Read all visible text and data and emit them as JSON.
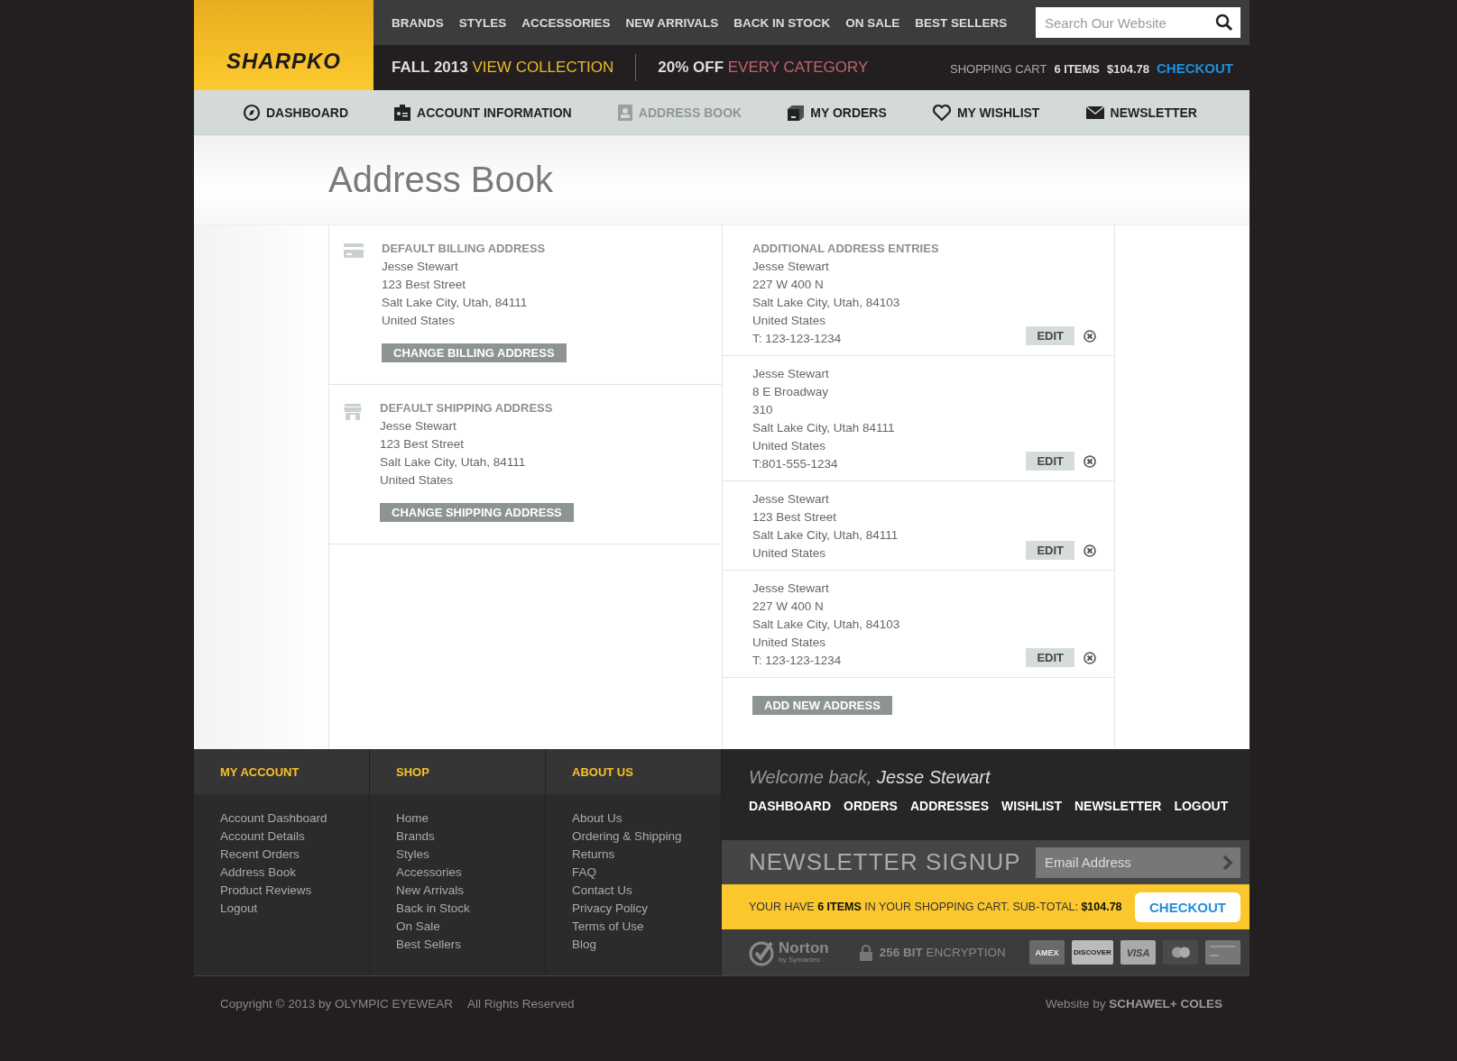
{
  "logo": "SHARPKO",
  "top_nav": [
    "BRANDS",
    "STYLES",
    "ACCESSORIES",
    "NEW ARRIVALS",
    "BACK IN STOCK",
    "ON SALE",
    "BEST SELLERS"
  ],
  "search": {
    "placeholder": "Search Our Website"
  },
  "promos": [
    {
      "lead": "FALL 2013",
      "link": "VIEW COLLECTION",
      "color": "#e9b92b"
    },
    {
      "lead": "20% OFF",
      "link": "EVERY CATEGORY",
      "color": "#c2636f"
    }
  ],
  "cart": {
    "label": "SHOPPING CART",
    "items": "6 ITEMS",
    "total": "$104.78",
    "checkout": "CHECKOUT"
  },
  "account_nav": [
    {
      "kind": "dashboard",
      "label": "DASHBOARD",
      "selected": false
    },
    {
      "kind": "account",
      "label": "ACCOUNT INFORMATION",
      "selected": false
    },
    {
      "kind": "addressbook",
      "label": "ADDRESS BOOK",
      "selected": true
    },
    {
      "kind": "orders",
      "label": "MY ORDERS",
      "selected": false
    },
    {
      "kind": "wishlist",
      "label": "MY WISHLIST",
      "selected": false
    },
    {
      "kind": "newsletter",
      "label": "NEWSLETTER",
      "selected": false
    }
  ],
  "page_title": "Address Book",
  "default_addresses": [
    {
      "kind": "billing",
      "heading": "DEFAULT BILLING ADDRESS",
      "lines": [
        "Jesse Stewart",
        "123 Best Street",
        "Salt Lake City, Utah, 84111",
        "United States"
      ],
      "button": "CHANGE BILLING ADDRESS"
    },
    {
      "kind": "shipping",
      "heading": "DEFAULT SHIPPING ADDRESS",
      "lines": [
        "Jesse Stewart",
        "123 Best Street",
        "Salt Lake City, Utah, 84111",
        "United States"
      ],
      "button": "CHANGE SHIPPING ADDRESS"
    }
  ],
  "additional": {
    "heading": "ADDITIONAL ADDRESS ENTRIES",
    "entries": [
      {
        "lines": [
          "Jesse Stewart",
          "227 W 400 N",
          "Salt Lake City, Utah, 84103",
          "United States",
          "T: 123-123-1234"
        ],
        "edit": "EDIT"
      },
      {
        "lines": [
          "Jesse Stewart",
          "8 E Broadway",
          "310",
          "Salt Lake City, Utah 84111",
          "United States",
          "T:801-555-1234"
        ],
        "edit": "EDIT"
      },
      {
        "lines": [
          "Jesse Stewart",
          "123 Best Street",
          "Salt Lake City, Utah, 84111",
          "United States"
        ],
        "edit": "EDIT"
      },
      {
        "lines": [
          "Jesse Stewart",
          "227 W 400 N",
          "Salt Lake City, Utah, 84103",
          "United States",
          "T: 123-123-1234"
        ],
        "edit": "EDIT"
      }
    ],
    "add_button": "ADD NEW ADDRESS"
  },
  "footer": {
    "columns": [
      {
        "heading": "MY ACCOUNT",
        "links": [
          "Account Dashboard",
          "Account Details",
          "Recent Orders",
          "Address Book",
          "Product Reviews",
          "Logout"
        ]
      },
      {
        "heading": "SHOP",
        "links": [
          "Home",
          "Brands",
          "Styles",
          "Accessories",
          "New Arrivals",
          "Back in Stock",
          "On Sale",
          "Best Sellers"
        ]
      },
      {
        "heading": "ABOUT US",
        "links": [
          "About Us",
          "Ordering & Shipping",
          "Returns",
          "FAQ",
          "Contact Us",
          "Privacy Policy",
          "Terms of Use",
          "Blog"
        ]
      }
    ],
    "welcome": {
      "text": "Welcome back,",
      "name": "Jesse Stewart"
    },
    "account_links": [
      "DASHBOARD",
      "ORDERS",
      "ADDRESSES",
      "WISHLIST",
      "NEWSLETTER",
      "LOGOUT"
    ],
    "newsletter": {
      "title": "NEWSLETTER SIGNUP",
      "placeholder": "Email Address"
    },
    "cart_bar": {
      "text": "YOUR HAVE **6 ITEMS** IN YOUR SHOPPING CART. SUB-TOTAL: **$104.78**",
      "button": "CHECKOUT"
    },
    "norton": {
      "name": "Norton",
      "sub": "by Symantec"
    },
    "encryption": "**256 BIT** ENCRYPTION",
    "cards": [
      {
        "kind": "amex",
        "label": "AMEX"
      },
      {
        "kind": "discover",
        "label": "DISCOVER"
      },
      {
        "kind": "visa",
        "label": "VISA"
      },
      {
        "kind": "mastercard"
      },
      {
        "kind": "generic"
      }
    ]
  },
  "bottom": {
    "copyright": "Copyright © 2013 by OLYMPIC EYEWEAR",
    "rights": "All Rights Reserved",
    "credit": "Website by **SCHAWEL+ COLES**"
  }
}
